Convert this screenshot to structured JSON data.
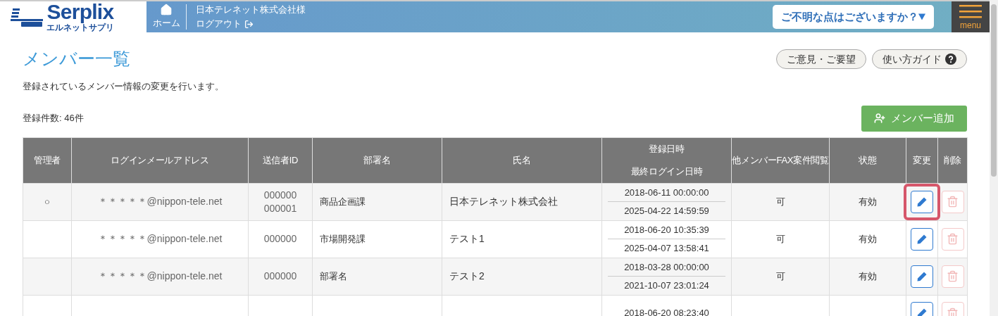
{
  "header": {
    "logo": {
      "brand": "Serplix",
      "reading": "エルネットサプリ"
    },
    "home": "ホーム",
    "company": "日本テレネット株式会社様",
    "logout": "ログアウト",
    "help_dropdown": "ご不明な点はございますか？",
    "menu": "menu"
  },
  "page": {
    "title": "メンバー一覧",
    "buttons": [
      {
        "label": "ご意見・ご要望",
        "kind": "plain"
      },
      {
        "label": "使い方ガイド",
        "kind": "help"
      }
    ],
    "description": "登録されているメンバー情報の変更を行います。",
    "count": "登録件数: 46件",
    "add_button": "メンバー追加"
  },
  "table": {
    "columns": [
      {
        "label": "管理者"
      },
      {
        "label": "ログインメールアドレス"
      },
      {
        "label": "送信者ID"
      },
      {
        "label": "部署名"
      },
      {
        "label": "氏名"
      },
      {
        "label": "登録日時",
        "sub_label": "最終ログイン日時"
      },
      {
        "label": "他メンバーFAX案件閲覧"
      },
      {
        "label": "状態"
      },
      {
        "label": "変更"
      },
      {
        "label": "削除"
      }
    ],
    "rows": [
      {
        "admin": "○",
        "email": "＊＊＊＊＊@nippon-tele.net",
        "sender_ids": [
          "000000",
          "000001"
        ],
        "department": "商品企画課",
        "name": "日本テレネット株式会社",
        "registered": "2018-06-11 00:00:00",
        "last_login": "2025-04-22 14:59:59",
        "fax_view": "可",
        "status": "有効",
        "edit_highlighted": true,
        "delete_disabled": true
      },
      {
        "email": "＊＊＊＊＊@nippon-tele.net",
        "sender_ids": [
          "000000"
        ],
        "department": "市場開発課",
        "name": "テスト1",
        "registered": "2018-06-20 10:35:39",
        "last_login": "2025-04-07 13:58:41",
        "fax_view": "可",
        "status": "有効",
        "edit_highlighted": false,
        "delete_disabled": true
      },
      {
        "email": "＊＊＊＊＊@nippon-tele.net",
        "sender_ids": [
          "000000"
        ],
        "department": "部署名",
        "name": "テスト2",
        "registered": "2018-03-28 00:00:00",
        "last_login": "2021-10-07 23:01:24",
        "fax_view": "可",
        "status": "有効",
        "edit_highlighted": false,
        "delete_disabled": true
      },
      {
        "registered": "2018-06-20 08:23:40",
        "edit_highlighted": false,
        "delete_disabled": true
      }
    ]
  }
}
